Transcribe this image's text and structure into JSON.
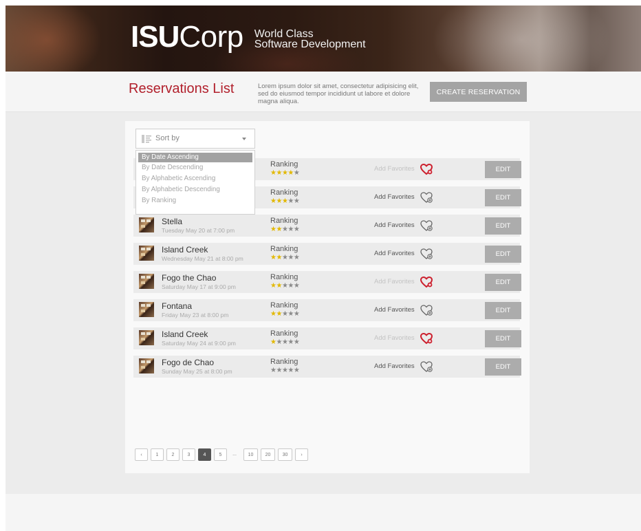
{
  "brand": {
    "logo_bold": "ISU",
    "logo_light": "Corp",
    "tagline_line1": "World Class",
    "tagline_line2": "Software Development"
  },
  "header": {
    "title": "Reservations List",
    "description": "Lorem ipsum dolor sit amet, consectetur adipisicing elit, sed do eiusmod tempor incididunt ut labore et dolore magna aliqua.",
    "create_label": "CREATE RESERVATION"
  },
  "sort": {
    "label": "Sort by",
    "options": [
      "By Date Ascending",
      "By Date Descending",
      "By Alphabetic Ascending",
      "By Alphabetic Descending",
      "By Ranking"
    ],
    "selected": "By Date Ascending"
  },
  "colors": {
    "accent": "#b11f2b",
    "star_on": "#e2b800",
    "star_off": "#8a8a8a",
    "button_gray": "#a4a4a4"
  },
  "reservations": [
    {
      "name": "",
      "date": "",
      "ranking_label": "Ranking",
      "stars": 4,
      "favorite_label": "Add Favorites",
      "favorited": true,
      "edit_label": "EDIT"
    },
    {
      "name": "",
      "date": "",
      "ranking_label": "Ranking",
      "stars": 3,
      "favorite_label": "Add Favorites",
      "favorited": false,
      "edit_label": "EDIT"
    },
    {
      "name": "Stella",
      "date": "Tuesday May 20 at 7:00 pm",
      "ranking_label": "Ranking",
      "stars": 2,
      "favorite_label": "Add Favorites",
      "favorited": false,
      "edit_label": "EDIT"
    },
    {
      "name": "Island Creek",
      "date": "Wednesday May 21 at 8:00 pm",
      "ranking_label": "Ranking",
      "stars": 2,
      "favorite_label": "Add Favorites",
      "favorited": false,
      "edit_label": "EDIT"
    },
    {
      "name": "Fogo the Chao",
      "date": "Saturday May 17 at 9:00 pm",
      "ranking_label": "Ranking",
      "stars": 2,
      "favorite_label": "Add Favorites",
      "favorited": true,
      "edit_label": "EDIT"
    },
    {
      "name": "Fontana",
      "date": "Friday May 23 at 8:00 pm",
      "ranking_label": "Ranking",
      "stars": 2,
      "favorite_label": "Add Favorites",
      "favorited": false,
      "edit_label": "EDIT"
    },
    {
      "name": "Island Creek",
      "date": "Saturday May 24 at 9:00 pm",
      "ranking_label": "Ranking",
      "stars": 1,
      "favorite_label": "Add Favorites",
      "favorited": true,
      "edit_label": "EDIT"
    },
    {
      "name": "Fogo de Chao",
      "date": "Sunday May 25 at 8:00 pm",
      "ranking_label": "Ranking",
      "stars": 0,
      "favorite_label": "Add Favorites",
      "favorited": false,
      "edit_label": "EDIT"
    }
  ],
  "pagination": {
    "prev": "‹",
    "next": "›",
    "pages": [
      "1",
      "2",
      "3",
      "4",
      "5",
      "...",
      "10",
      "20",
      "30"
    ],
    "current": "4"
  }
}
